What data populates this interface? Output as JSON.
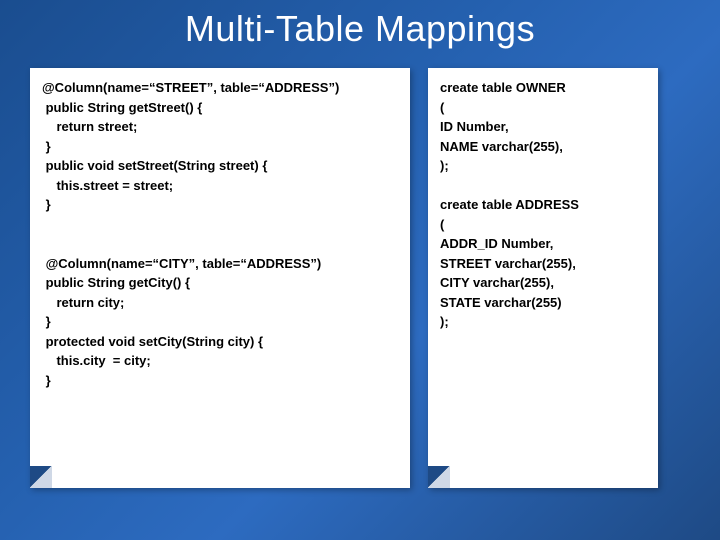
{
  "title": "Multi-Table Mappings",
  "left_code": "@Column(name=“STREET”, table=“ADDRESS”)\n public String getStreet() {\n    return street;\n }\n public void setStreet(String street) {\n    this.street = street;\n }\n\n\n @Column(name=“CITY”, table=“ADDRESS”)\n public String getCity() {\n    return city;\n }\n protected void setCity(String city) {\n    this.city  = city;\n }",
  "right_code": "create table OWNER\n(\nID Number,\nNAME varchar(255),\n);\n\ncreate table ADDRESS\n(\nADDR_ID Number,\nSTREET varchar(255),\nCITY varchar(255),\nSTATE varchar(255)\n);"
}
